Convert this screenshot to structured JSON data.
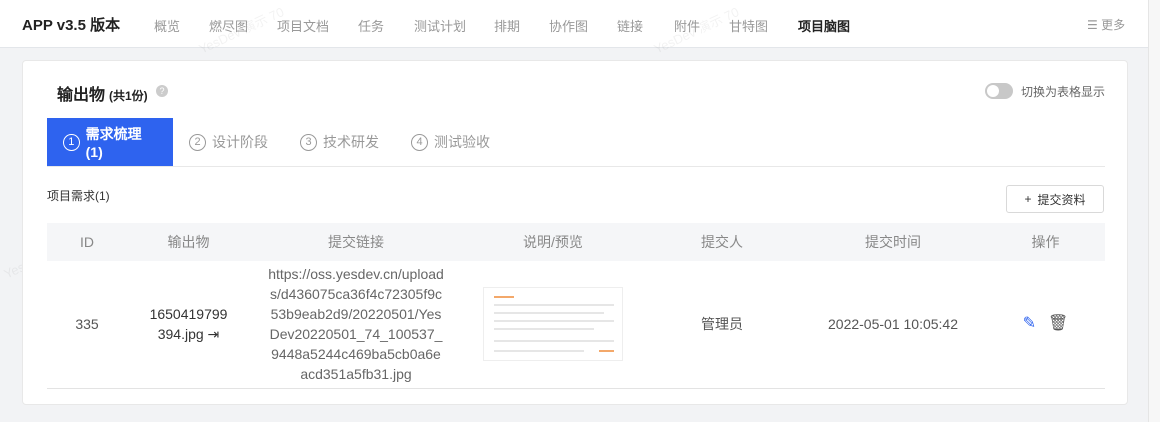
{
  "topbar": {
    "title": "APP v3.5 版本",
    "nav": [
      "概览",
      "燃尽图",
      "项目文档",
      "任务",
      "测试计划",
      "排期",
      "协作图",
      "链接",
      "附件",
      "甘特图",
      "项目脑图"
    ],
    "active": "项目脑图",
    "more": "更多"
  },
  "card": {
    "title": "输出物",
    "count": "(共1份)",
    "help": "?",
    "toggle_label": "切换为表格显示",
    "tabs": [
      {
        "num": "1",
        "label": "需求梳理(1)"
      },
      {
        "num": "2",
        "label": "设计阶段"
      },
      {
        "num": "3",
        "label": "技术研发"
      },
      {
        "num": "4",
        "label": "测试验收"
      }
    ],
    "section": "项目需求(1)",
    "submit_button": "提交资料",
    "columns": [
      "ID",
      "输出物",
      "提交链接",
      "说明/预览",
      "提交人",
      "提交时间",
      "操作"
    ],
    "rows": [
      {
        "id": "335",
        "file": "1650419799394.jpg",
        "link": "https://oss.yesdev.cn/uploads/d436075ca36f4c72305f9c53b9eab2d9/20220501/YesDev20220501_74_100537_9448a5244c469ba5cb0a6eacd351a5fb31.jpg",
        "submitter": "管理员",
        "time": "2022-05-01 10:05:42"
      }
    ]
  },
  "watermark": "YesDev 演示 70",
  "colors": {
    "accent": "#2e63ef"
  }
}
